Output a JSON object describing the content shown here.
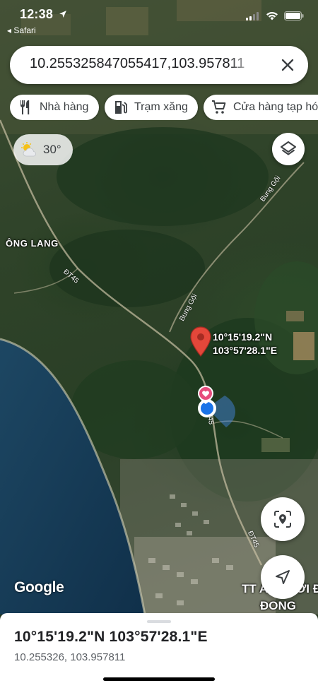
{
  "status_bar": {
    "time": "12:38",
    "back_app": "◂ Safari"
  },
  "search": {
    "value": "10.255325847055417,103.957811"
  },
  "chips": [
    {
      "icon": "restaurant-icon",
      "label": "Nhà hàng"
    },
    {
      "icon": "gas-station-icon",
      "label": "Trạm xăng"
    },
    {
      "icon": "shopping-cart-icon",
      "label": "Cửa hàng tạp hóa"
    }
  ],
  "weather": {
    "icon": "partly-cloudy-icon",
    "temperature": "30°"
  },
  "map": {
    "labels": {
      "area_west": "ÔNG LANG",
      "area_southeast": "TT AN THỚI ĐONG",
      "area_southeast_line2": "ĐONG",
      "road_dt45": "ĐT45",
      "road_dt45_b": "ĐT45",
      "road_45": "45",
      "road_bung_goi": "Bung Gội",
      "road_bung_goi_b": "Bung Gội"
    },
    "pin_label": {
      "lat": "10°15'19.2\"N",
      "lng": "103°57'28.1\"E"
    },
    "attribution": "Google"
  },
  "bottom_sheet": {
    "title": "10°15'19.2\"N 103°57'28.1\"E",
    "subtitle": "10.255326, 103.957811"
  },
  "colors": {
    "pin_red": "#e4473a",
    "location_blue": "#1a73e8",
    "saved_pink": "#e74d7d",
    "sea": "#173a55"
  }
}
